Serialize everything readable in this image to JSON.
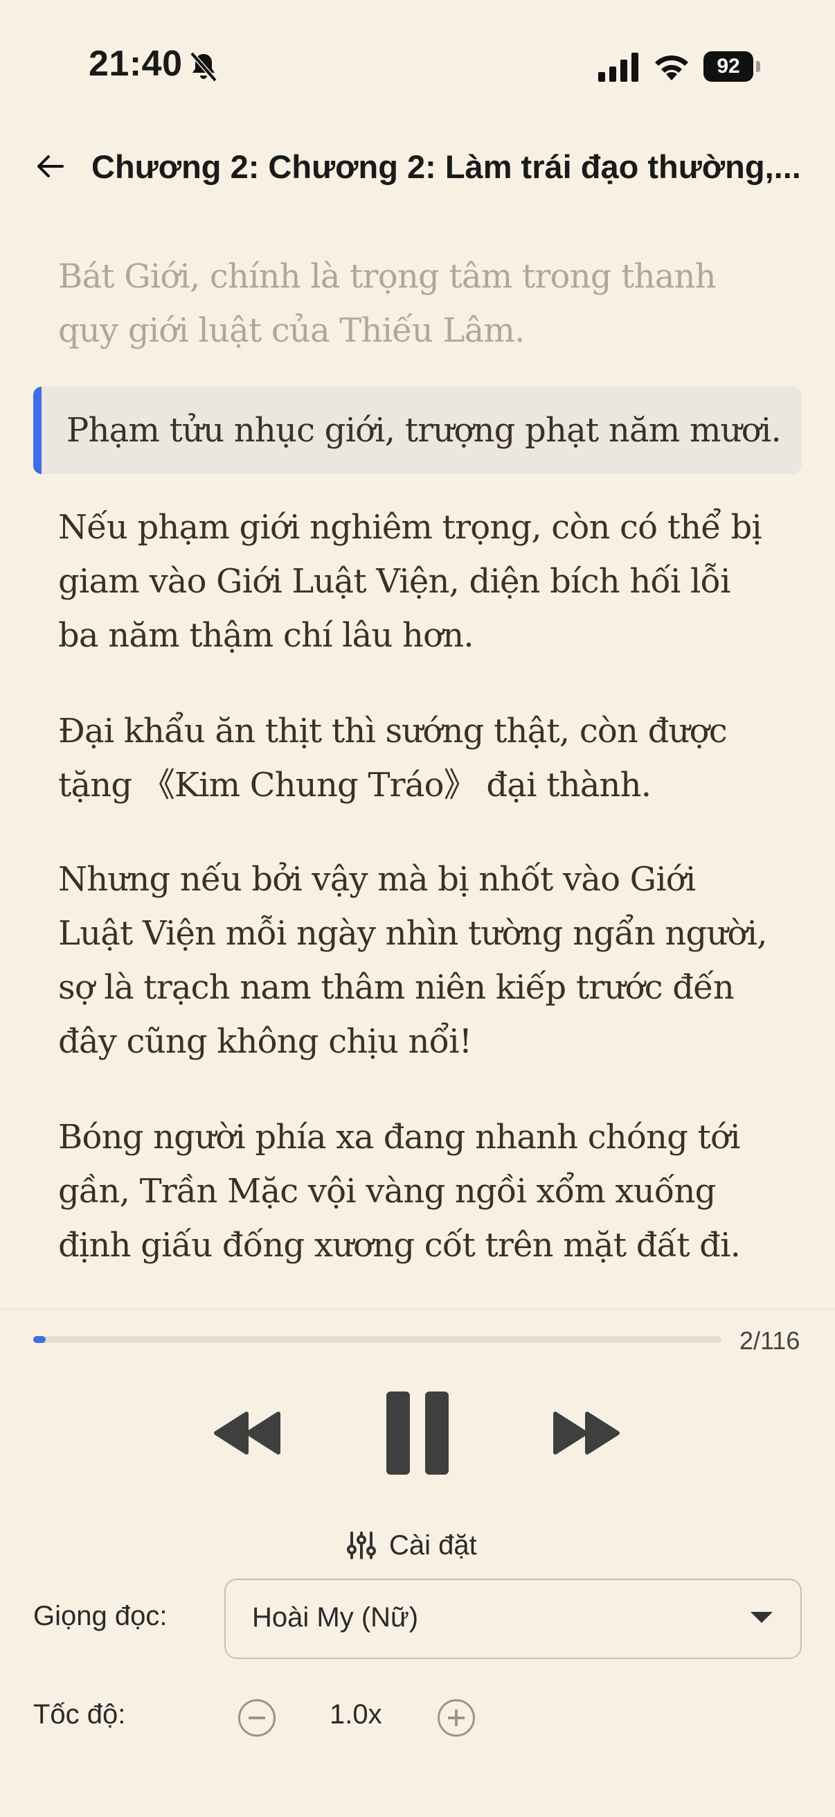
{
  "status_bar": {
    "time": "21:40",
    "battery": "92"
  },
  "header": {
    "title": "Chương 2: Chương 2: Làm trái đạo thường,..."
  },
  "content": {
    "paragraphs": [
      "Bát Giới, chính là trọng tâm trong thanh quy giới luật của Thiếu Lâm.",
      "Phạm tửu nhục giới, trượng phạt năm mươi.",
      "Nếu phạm giới nghiêm trọng, còn có thể bị giam vào Giới Luật Viện, diện bích hối lỗi ba năm thậm chí lâu hơn.",
      "Đại khẩu ăn thịt thì sướng thật, còn được tặng 《Kim Chung Tráo》 đại thành.",
      "Nhưng nếu bởi vậy mà bị nhốt vào Giới Luật Viện mỗi ngày nhìn tường ngẩn người, sợ là trạch nam thâm niên kiếp trước đến đây cũng không chịu nổi!",
      "Bóng người phía xa đang nhanh chóng tới gần, Trần Mặc vội vàng ngồi xổm xuống định giấu đống xương cốt trên mặt đất đi."
    ],
    "active_paragraph_index": 1
  },
  "player": {
    "progress_label": "2/116",
    "current": 2,
    "total": 116,
    "state": "playing",
    "icons": [
      "rewind-icon",
      "pause-icon",
      "fast-forward-icon"
    ]
  },
  "settings": {
    "label": "Cài đặt",
    "voice_label": "Giọng đọc:",
    "voice_value": "Hoài My (Nữ)",
    "speed_label": "Tốc độ:",
    "speed_value": "1.0x"
  },
  "colors": {
    "background": "#f8f0e3",
    "accent": "#3d6ee6",
    "highlight_bg": "#ebe6df",
    "text": "#3a3125",
    "faded_text": "#b0a797"
  }
}
